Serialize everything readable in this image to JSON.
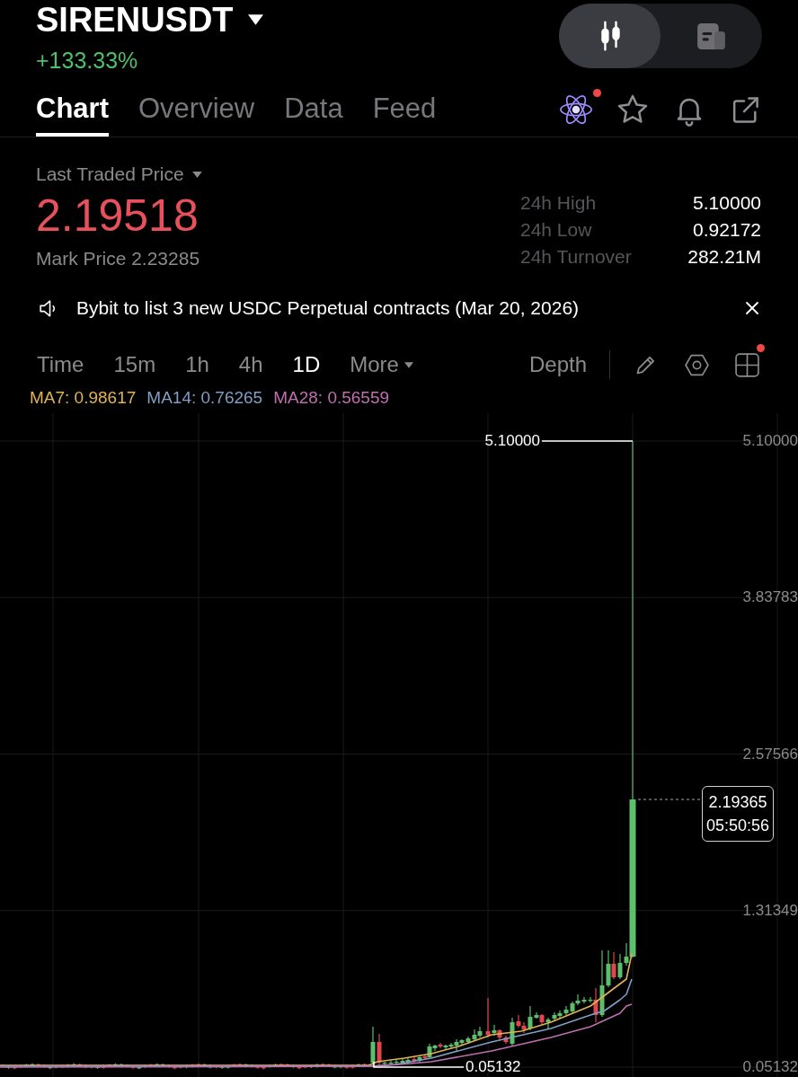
{
  "symbol": {
    "name": "SIRENUSDT",
    "change": "+133.33%",
    "change_up": true
  },
  "view_toggle": [
    {
      "kind": "chart",
      "selected": true
    },
    {
      "kind": "news",
      "selected": false
    }
  ],
  "tabs": [
    {
      "label": "Chart",
      "selected": true
    },
    {
      "label": "Overview",
      "selected": false
    },
    {
      "label": "Data",
      "selected": false
    },
    {
      "label": "Feed",
      "selected": false
    }
  ],
  "header_actions": [
    {
      "kind": "assistant",
      "badge": true
    },
    {
      "kind": "favorite",
      "badge": false
    },
    {
      "kind": "alert",
      "badge": false
    },
    {
      "kind": "share",
      "badge": false
    }
  ],
  "price": {
    "label": "Last Traded Price",
    "value": "2.19518",
    "up": false,
    "mark_price": "Mark Price 2.23285"
  },
  "stats": [
    {
      "label": "24h High",
      "value": "5.10000"
    },
    {
      "label": "24h Low",
      "value": "0.92172"
    },
    {
      "label": "24h Turnover",
      "value": "282.21M"
    }
  ],
  "announcement": {
    "text": "Bybit to list 3 new USDC Perpetual contracts (Mar 20, 2026)"
  },
  "timeframes": [
    {
      "label": "Time",
      "kind": "interval",
      "selected": false
    },
    {
      "label": "15m",
      "kind": "interval",
      "selected": false
    },
    {
      "label": "1h",
      "kind": "interval",
      "selected": false
    },
    {
      "label": "4h",
      "kind": "interval",
      "selected": false
    },
    {
      "label": "1D",
      "kind": "interval",
      "selected": true
    },
    {
      "label": "More",
      "kind": "menu",
      "selected": false
    }
  ],
  "depth": {
    "label": "Depth"
  },
  "chart_tools": [
    {
      "kind": "draw",
      "badge": false
    },
    {
      "kind": "settings",
      "badge": false
    },
    {
      "kind": "layout",
      "badge": true
    }
  ],
  "ma_legend": [
    {
      "label": "MA7: 0.98617",
      "color": "#e0b357"
    },
    {
      "label": "MA14: 0.76265",
      "color": "#7f9fc4"
    },
    {
      "label": "MA28: 0.56559",
      "color": "#bf6fae"
    }
  ],
  "chart": {
    "y_labels": [
      "5.10000",
      "3.83783",
      "2.57566",
      "1.31349",
      "0.05132"
    ],
    "high_label": "5.10000",
    "low_label": "0.05132",
    "price_tag": {
      "price": "2.19365",
      "countdown": "05:50:56"
    }
  }
}
